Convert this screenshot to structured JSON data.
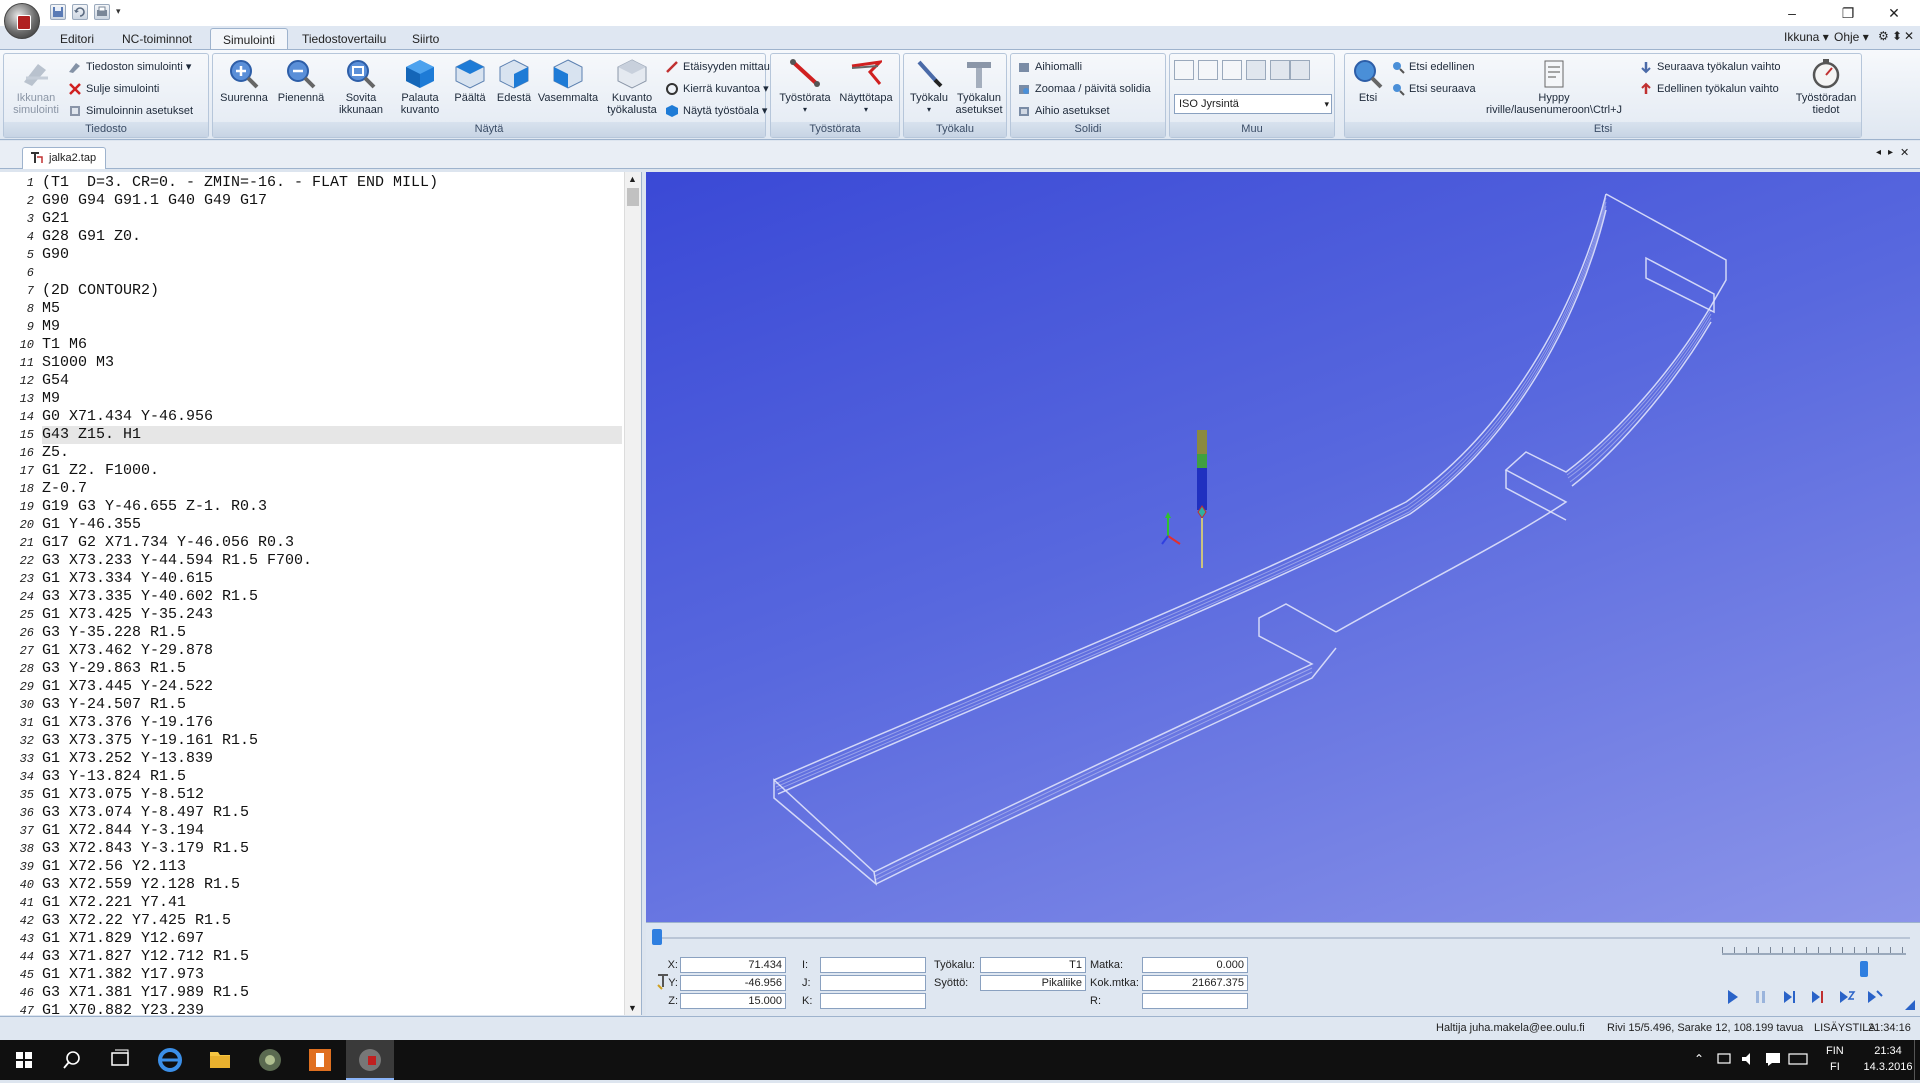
{
  "quick_access": [
    "save-icon",
    "undo-icon",
    "print-icon",
    "dropdown-arrow-icon"
  ],
  "window_controls": {
    "minimize": "–",
    "maximize": "❐",
    "close": "✕"
  },
  "ribbon_tabs": [
    {
      "label": "Editori",
      "active": false
    },
    {
      "label": "NC-toiminnot",
      "active": false
    },
    {
      "label": "Simulointi",
      "active": true
    },
    {
      "label": "Tiedostovertailu",
      "active": false
    },
    {
      "label": "Siirto",
      "active": false
    }
  ],
  "right_menus": {
    "ikkuna": "Ikkuna",
    "ohje": "Ohje"
  },
  "groups": {
    "tiedosto": {
      "label": "Tiedosto",
      "big": {
        "label1": "Ikkunan",
        "label2": "simulointi"
      },
      "small": [
        "Tiedoston simulointi",
        "Sulje simulointi",
        "Simuloinnin asetukset"
      ]
    },
    "nayta": {
      "label": "Näytä",
      "big": [
        {
          "l1": "Suurenna",
          "l2": ""
        },
        {
          "l1": "Pienennä",
          "l2": ""
        },
        {
          "l1": "Sovita",
          "l2": "ikkunaan"
        },
        {
          "l1": "Palauta",
          "l2": "kuvanto"
        },
        {
          "l1": "Päältä",
          "l2": ""
        },
        {
          "l1": "Edestä",
          "l2": ""
        },
        {
          "l1": "Vasemmalta",
          "l2": ""
        },
        {
          "l1": "Kuvanto",
          "l2": "työkalusta"
        }
      ],
      "small": [
        "Etäisyyden mittaus",
        "Kierrä kuvantoa",
        "Näytä työstöala"
      ]
    },
    "tyostorata": {
      "label": "Työstörata",
      "big": [
        "Työstörata",
        "Näyttötapa"
      ]
    },
    "tyokalu": {
      "label": "Työkalu",
      "big": [
        {
          "l1": "Työkalu",
          "l2": ""
        },
        {
          "l1": "Työkalun",
          "l2": "asetukset"
        }
      ]
    },
    "solidi": {
      "label": "Solidi",
      "small": [
        "Aihiomalli",
        "Zoomaa / päivitä solidia",
        "Aihio asetukset"
      ]
    },
    "muu": {
      "label": "Muu",
      "select": "ISO Jyrsintä"
    },
    "etsi": {
      "label": "Etsi",
      "etsi": "Etsi",
      "small": [
        "Etsi edellinen",
        "Etsi seuraava"
      ],
      "hyppy": {
        "l1": "Hyppy",
        "l2": "riville/lausenumeroon\\Ctrl+J"
      },
      "small2": [
        "Seuraava työkalun vaihto",
        "Edellinen työkalun vaihto"
      ],
      "tyostoradan": {
        "l1": "Työstöradan",
        "l2": "tiedot"
      }
    }
  },
  "document_tab": "jalka2.tap",
  "code_lines": [
    "(T1  D=3. CR=0. - ZMIN=-16. - FLAT END MILL)",
    "G90 G94 G91.1 G40 G49 G17",
    "G21",
    "G28 G91 Z0.",
    "G90",
    "",
    "(2D CONTOUR2)",
    "M5",
    "M9",
    "T1 M6",
    "S1000 M3",
    "G54",
    "M9",
    "G0 X71.434 Y-46.956",
    "G43 Z15. H1",
    "Z5.",
    "G1 Z2. F1000.",
    "Z-0.7",
    "G19 G3 Y-46.655 Z-1. R0.3",
    "G1 Y-46.355",
    "G17 G2 X71.734 Y-46.056 R0.3",
    "G3 X73.233 Y-44.594 R1.5 F700.",
    "G1 X73.334 Y-40.615",
    "G3 X73.335 Y-40.602 R1.5",
    "G1 X73.425 Y-35.243",
    "G3 Y-35.228 R1.5",
    "G1 X73.462 Y-29.878",
    "G3 Y-29.863 R1.5",
    "G1 X73.445 Y-24.522",
    "G3 Y-24.507 R1.5",
    "G1 X73.376 Y-19.176",
    "G3 X73.375 Y-19.161 R1.5",
    "G1 X73.252 Y-13.839",
    "G3 Y-13.824 R1.5",
    "G1 X73.075 Y-8.512",
    "G3 X73.074 Y-8.497 R1.5",
    "G1 X72.844 Y-3.194",
    "G3 X72.843 Y-3.179 R1.5",
    "G1 X72.56 Y2.113",
    "G3 X72.559 Y2.128 R1.5",
    "G1 X72.221 Y7.41",
    "G3 X72.22 Y7.425 R1.5",
    "G1 X71.829 Y12.697",
    "G3 X71.827 Y12.712 R1.5",
    "G1 X71.382 Y17.973",
    "G3 X71.381 Y17.989 R1.5",
    "G1 X70.882 Y23.239"
  ],
  "current_line": 15,
  "coords": {
    "x_label": "X:",
    "y_label": "Y:",
    "z_label": "Z:",
    "i_label": "I:",
    "j_label": "J:",
    "k_label": "K:",
    "x": "71.434",
    "y": "-46.956",
    "z": "15.000",
    "tyokalu_label": "Työkalu:",
    "tyokalu": "T1",
    "syotto_label": "Syöttö:",
    "syotto": "Pikaliike",
    "matka_label": "Matka:",
    "matka": "0.000",
    "kokmtka_label": "Kok.mtka:",
    "kokmtka": "21667.375",
    "r_label": "R:"
  },
  "progress": 0.0,
  "speed": 0.77,
  "status": {
    "haltija": "Haltija juha.makela@ee.oulu.fi",
    "position": "Rivi 15/5.496, Sarake 12, 108.199 tavua",
    "mode": "LISÄYSTILA",
    "time": "21:34:16"
  },
  "taskbar": {
    "lang1": "FIN",
    "lang2": "FI",
    "clock": "21:34",
    "date": "14.3.2016"
  },
  "colors": {
    "accent": "#9eb3cd",
    "viewport": "#5868de",
    "tool_blue": "#2030c0",
    "tool_green": "#40a040",
    "tool_olive": "#8a8a40"
  }
}
